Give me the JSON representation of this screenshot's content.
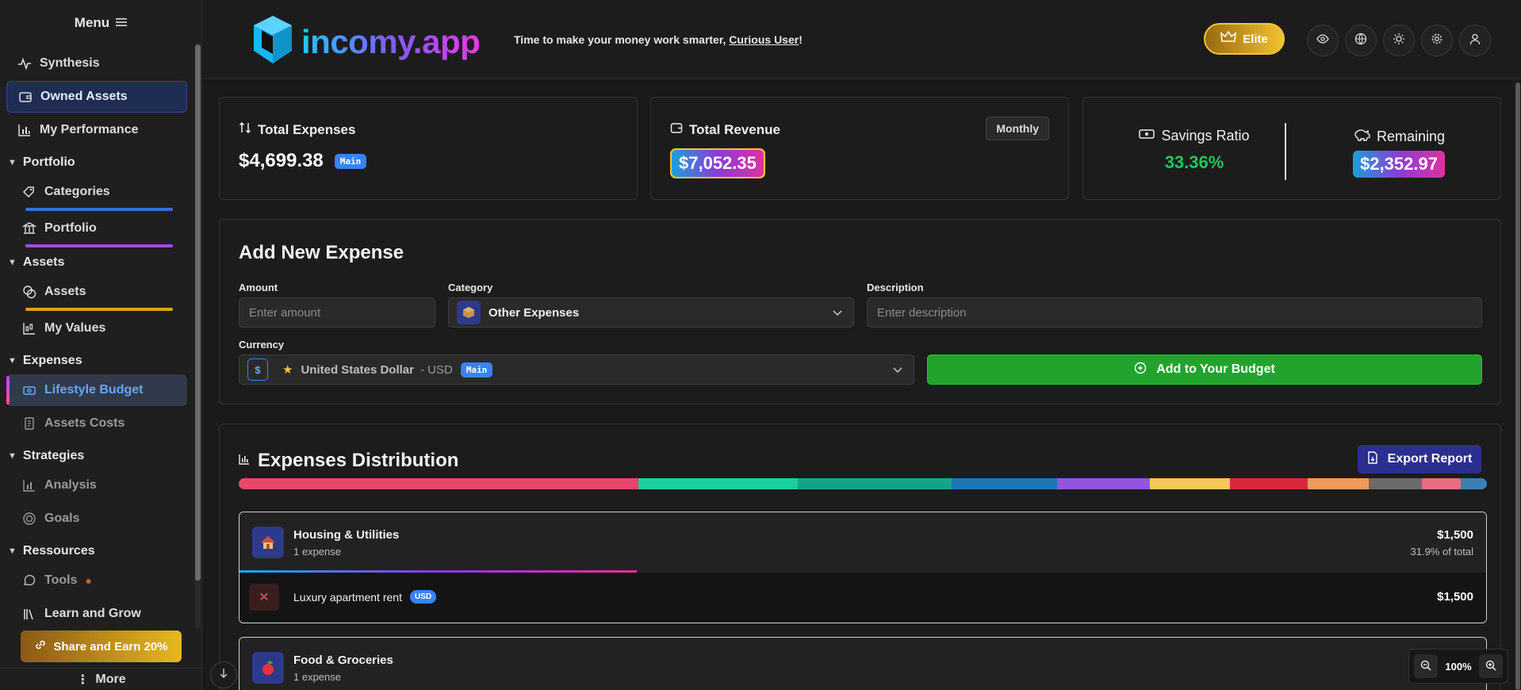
{
  "sidebar": {
    "menu_label": "Menu",
    "items": {
      "synthesis": "Synthesis",
      "owned_assets": "Owned Assets",
      "my_performance": "My Performance",
      "portfolio_section": "Portfolio",
      "categories": "Categories",
      "portfolio": "Portfolio",
      "assets_section": "Assets",
      "assets": "Assets",
      "my_values": "My Values",
      "expenses_section": "Expenses",
      "lifestyle_budget": "Lifestyle Budget",
      "assets_costs": "Assets Costs",
      "strategies_section": "Strategies",
      "analysis": "Analysis",
      "goals": "Goals",
      "ressources_section": "Ressources",
      "tools": "Tools",
      "learn_and_grow": "Learn and Grow"
    },
    "share_label": "Share and Earn 20%",
    "more_label": "More"
  },
  "header": {
    "logo_text": "incomy.app",
    "tagline_prefix": "Time to make your money work smarter, ",
    "tagline_user": "Curious User",
    "tagline_suffix": "!",
    "elite_label": "Elite"
  },
  "stats": {
    "total_expenses_label": "Total Expenses",
    "total_expenses_value": "$4,699.38",
    "main_tag": "Main",
    "total_revenue_label": "Total Revenue",
    "total_revenue_value": "$7,052.35",
    "period_label": "Monthly",
    "savings_ratio_label": "Savings Ratio",
    "savings_ratio_value": "33.36%",
    "remaining_label": "Remaining",
    "remaining_value": "$2,352.97"
  },
  "add_expense": {
    "title": "Add New Expense",
    "amount_label": "Amount",
    "amount_placeholder": "Enter amount",
    "category_label": "Category",
    "category_value": "Other Expenses",
    "description_label": "Description",
    "description_placeholder": "Enter description",
    "currency_label": "Currency",
    "currency_symbol": "$",
    "currency_name": "United States Dollar",
    "currency_code": "- USD",
    "currency_tag": "Main",
    "add_button_label": "Add to Your Budget"
  },
  "distribution": {
    "title": "Expenses Distribution",
    "export_label": "Export Report",
    "segments": [
      {
        "color": "#e8466b",
        "share": 31.9
      },
      {
        "color": "#1ccfa0",
        "share": 12.7
      },
      {
        "color": "#13a58a",
        "share": 12.3
      },
      {
        "color": "#1b78b5",
        "share": 8.4
      },
      {
        "color": "#9356de",
        "share": 7.4
      },
      {
        "color": "#f6c85a",
        "share": 6.4
      },
      {
        "color": "#d9283e",
        "share": 6.2
      },
      {
        "color": "#ee9a5a",
        "share": 4.9
      },
      {
        "color": "#6b6b6b",
        "share": 4.2
      },
      {
        "color": "#e96d82",
        "share": 3.1
      },
      {
        "color": "#3b7fb5",
        "share": 2.1
      }
    ],
    "groups": [
      {
        "name": "Housing & Utilities",
        "icon": "house-icon",
        "count": "1 expense",
        "amount": "$1,500",
        "percent_text": "31.9% of total",
        "share": 31.9,
        "rows": [
          {
            "description": "Luxury apartment rent",
            "currency": "USD",
            "amount": "$1,500"
          }
        ]
      },
      {
        "name": "Food & Groceries",
        "icon": "apple-icon",
        "count": "1 expense"
      }
    ]
  },
  "zoom": {
    "value": "100%"
  },
  "colors": {
    "accent_blue": "#3b82f6",
    "green": "#22a32e",
    "savings_green": "#22c55e",
    "elite_gold": "#e8b81e"
  }
}
